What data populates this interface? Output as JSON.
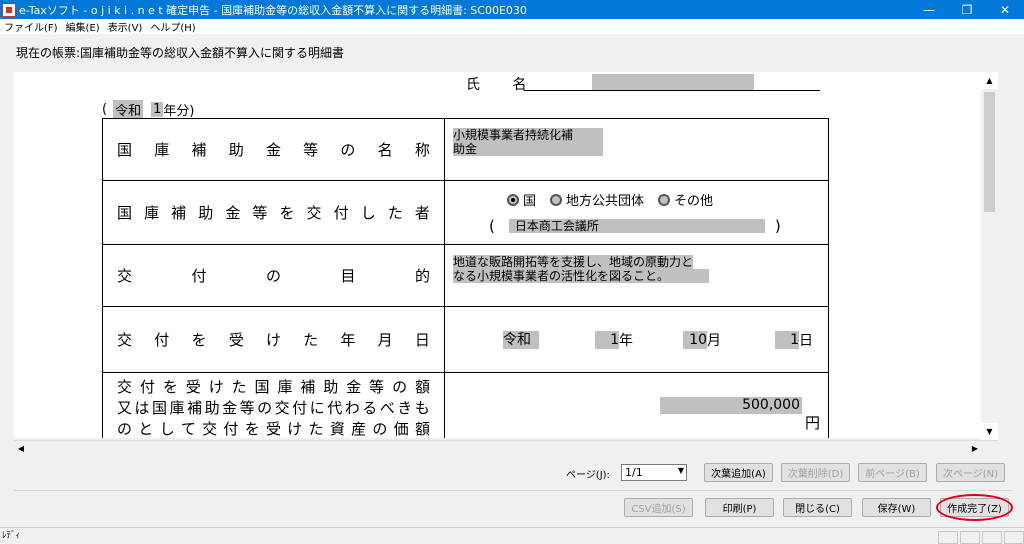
{
  "window": {
    "title": "e-Taxソフト - o j i k i . n e t    確定申告 - 国庫補助金等の総収入金額不算入に関する明細書: SC00E030",
    "controls": [
      "—",
      "❐",
      "✕"
    ]
  },
  "menu": [
    "ファイル(F)",
    "編集(E)",
    "表示(V)",
    "ヘルプ(H)"
  ],
  "current_form_label": "現在の帳票:国庫補助金等の総収入金額不算入に関する明細書",
  "form": {
    "name_label": "氏 名",
    "year_open": "(",
    "era": "令和",
    "year": "1",
    "year_suffix": "年分)",
    "rows": {
      "subsidy_name": {
        "label": "国庫補助金等の名称",
        "value_line1": "小規模事業者持続化補",
        "value_line2": "助金"
      },
      "grantor": {
        "label": "国庫補助金等を交付した者",
        "options": [
          "国",
          "地方公共団体",
          "その他"
        ],
        "selected": "国",
        "paren_open": "(",
        "paren_close": ")",
        "grantor_name": "日本商工会議所"
      },
      "purpose": {
        "label": "交付の目的",
        "value_line1": "地道な販路開拓等を支援し、地域の原動力と",
        "value_line2": "なる小規模事業者の活性化を図ること。"
      },
      "date": {
        "label": "交付を受けた年月日",
        "era": "令和",
        "year": "1",
        "year_unit": "年",
        "month": "10",
        "month_unit": "月",
        "day": "1",
        "day_unit": "日"
      },
      "amount": {
        "label_line1": "交付を受けた国庫補助金等の額",
        "label_line2": "又は国庫補助金等の交付に代わるべきも",
        "label_line3": "のとして交付を受けた資産の価額",
        "value": "500,000",
        "unit": "円"
      }
    }
  },
  "pager": {
    "page_label": "ページ(J):",
    "page_value": "1/1",
    "add_page": "次葉追加(A)",
    "delete_page": "次葉削除(D)",
    "prev_page": "前ページ(B)",
    "next_page": "次ページ(N)"
  },
  "actions": {
    "csv_add": "CSV追加(S)",
    "print": "印刷(P)",
    "close": "閉じる(C)",
    "save": "保存(W)",
    "complete": "作成完了(Z)"
  },
  "status": "ﾚﾃﾞｨ",
  "colors": {
    "titlebar": "#0078d7",
    "field_fill": "#c0c0c0",
    "highlight_circle": "#e0001b"
  }
}
